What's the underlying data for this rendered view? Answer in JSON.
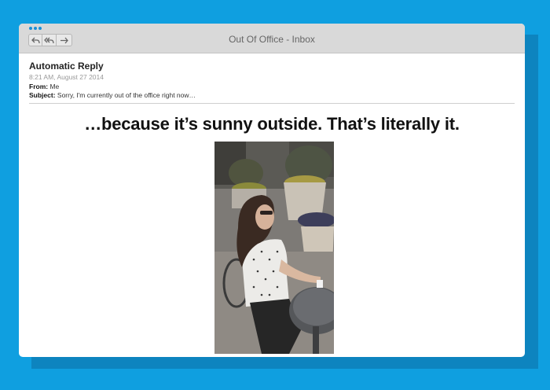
{
  "window": {
    "title": "Out Of Office - Inbox"
  },
  "toolbar": {
    "reply_icon": "reply-icon",
    "reply_all_icon": "reply-all-icon",
    "forward_icon": "forward-icon"
  },
  "email": {
    "subject_title": "Automatic Reply",
    "timestamp": "8:21 AM, August 27 2014",
    "from_label": "From:",
    "from_value": "Me",
    "subject_label": "Subject:",
    "subject_value": "Sorry, I'm currently out of the office right now…",
    "headline": "…because it’s sunny outside. That’s literally it."
  },
  "colors": {
    "background": "#0f9fe0",
    "titlebar": "#d9d9d9",
    "accent": "#1a8fd6"
  }
}
